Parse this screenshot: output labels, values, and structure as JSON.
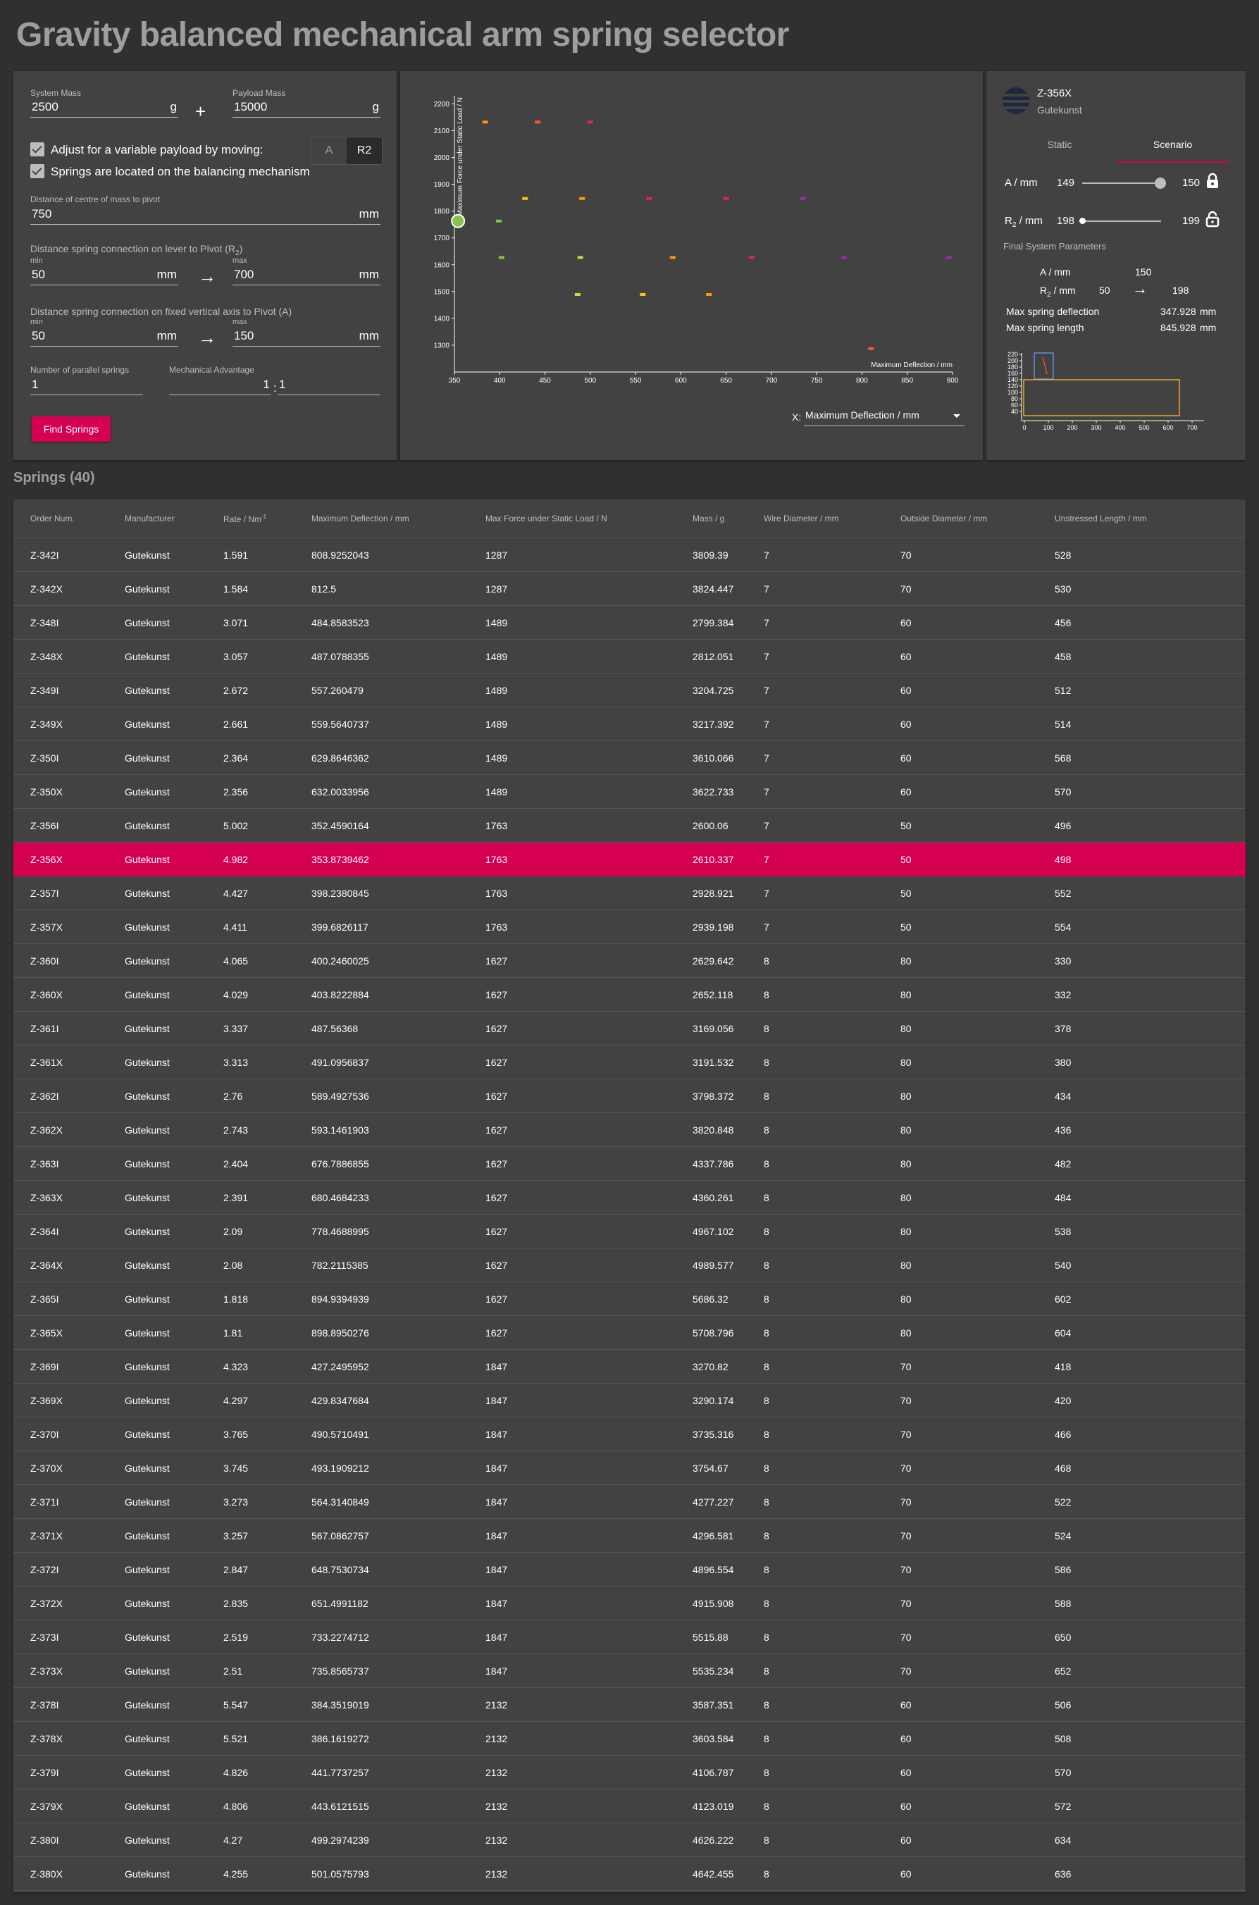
{
  "title": "Gravity balanced mechanical arm spring selector",
  "form": {
    "system_mass_label": "System Mass",
    "system_mass": "2500",
    "system_mass_unit": "g",
    "plus": "+",
    "payload_mass_label": "Payload Mass",
    "payload_mass": "15000",
    "payload_mass_unit": "g",
    "variable_payload_label": "Adjust for a variable payload by moving:",
    "toggle_a": "A",
    "toggle_r2": "R2",
    "springs_located_label": "Springs are located on the balancing mechanism",
    "com_label": "Distance of centre of mass to pivot",
    "com_value": "750",
    "com_unit": "mm",
    "lever_label": "Distance spring connection on lever to Pivot (R",
    "lever_label_sub": "2",
    "lever_label_end": ")",
    "lever_min_label": "min",
    "lever_min": "50",
    "lever_max_label": "max",
    "lever_max": "700",
    "unit_mm": "mm",
    "arrow": "→",
    "axis_label": "Distance spring connection on fixed vertical axis to Pivot (A)",
    "axis_min_label": "min",
    "axis_min": "50",
    "axis_max_label": "max",
    "axis_max": "150",
    "parallel_label": "Number of parallel springs",
    "parallel_value": "1",
    "mech_adv_label": "Mechanical Advantage",
    "mech_adv_left": "1",
    "mech_adv_sep": ":",
    "mech_adv_right": "1",
    "find_button": "Find Springs"
  },
  "chart_data": {
    "type": "scatter",
    "xlabel": "Maximum Deflection / mm",
    "ylabel": "Maximum Force under Static Load / N",
    "xlim": [
      350,
      900
    ],
    "ylim": [
      1200,
      2230
    ],
    "xticks": [
      350,
      400,
      450,
      500,
      550,
      600,
      650,
      700,
      750,
      800,
      850,
      900
    ],
    "yticks": [
      1300,
      1400,
      1500,
      1600,
      1700,
      1800,
      1900,
      2000,
      2100,
      2200
    ],
    "points": [
      {
        "x": 384,
        "y": 2132,
        "color": "#ff9800"
      },
      {
        "x": 442,
        "y": 2132,
        "color": "#ff5722"
      },
      {
        "x": 500,
        "y": 2132,
        "color": "#e91e63"
      },
      {
        "x": 428,
        "y": 1847,
        "color": "#ffc107"
      },
      {
        "x": 491,
        "y": 1847,
        "color": "#ff9800"
      },
      {
        "x": 565,
        "y": 1847,
        "color": "#e91e63"
      },
      {
        "x": 650,
        "y": 1847,
        "color": "#e91e63"
      },
      {
        "x": 735,
        "y": 1847,
        "color": "#9c27b0"
      },
      {
        "x": 352,
        "y": 1763,
        "color": "#ffffff"
      },
      {
        "x": 399,
        "y": 1763,
        "color": "#8bc34a"
      },
      {
        "x": 402,
        "y": 1627,
        "color": "#8bc34a"
      },
      {
        "x": 489,
        "y": 1627,
        "color": "#cddc39"
      },
      {
        "x": 591,
        "y": 1627,
        "color": "#ff9800"
      },
      {
        "x": 678,
        "y": 1627,
        "color": "#e91e63"
      },
      {
        "x": 780,
        "y": 1627,
        "color": "#9c27b0"
      },
      {
        "x": 896,
        "y": 1627,
        "color": "#9c27b0"
      },
      {
        "x": 486,
        "y": 1489,
        "color": "#cddc39"
      },
      {
        "x": 558,
        "y": 1489,
        "color": "#ffc107"
      },
      {
        "x": 631,
        "y": 1489,
        "color": "#ff9800"
      },
      {
        "x": 810,
        "y": 1287,
        "color": "#ff5722"
      }
    ],
    "selected": {
      "x": 354,
      "y": 1763
    }
  },
  "chart_ui": {
    "x_select_label": "X:",
    "x_select_value": "Maximum Deflection / mm"
  },
  "spring_card": {
    "name": "Z-356X",
    "manufacturer": "Gutekunst",
    "tab_static": "Static",
    "tab_scenario": "Scenario",
    "a_label": "A / mm",
    "a_current": "149",
    "a_max": "150",
    "a_fraction": 0.99,
    "r2_label": "R",
    "r2_sub": "2",
    "r2_label_end": " / mm",
    "r2_current": "198",
    "r2_max": "199",
    "r2_fraction": 0.0,
    "final_title": "Final System Parameters",
    "final_a_label": "A / mm",
    "final_a_value": "150",
    "final_r2_label": "R",
    "final_r2_sub": "2",
    "final_r2_label_end": " / mm",
    "final_r2_from": "50",
    "final_r2_arrow": "→",
    "final_r2_to": "198",
    "max_def_label": "Max spring deflection",
    "max_def_value": "347.928",
    "max_def_unit": "mm",
    "max_len_label": "Max spring length",
    "max_len_value": "845.928",
    "max_len_unit": "mm"
  },
  "mini_chart": {
    "yticks": [
      "220",
      "200",
      "180",
      "160",
      "140",
      "120",
      "100",
      "80",
      "60",
      "40"
    ],
    "xticks": [
      "0",
      "100",
      "200",
      "300",
      "400",
      "500",
      "600",
      "700"
    ],
    "outline_colors": {
      "blue": "#5b8fd6",
      "orange": "#f5a623"
    }
  },
  "springs": {
    "title": "Springs (40)",
    "columns": [
      "Order Num.",
      "Manufacturer",
      "Rate / Nm",
      "Maximum Deflection / mm",
      "Max Force under Static Load / N",
      "Mass / g",
      "Wire Diameter / mm",
      "Outside Diameter / mm",
      "Unstressed Length / mm"
    ],
    "rate_sup": "-1",
    "selected_index": 9,
    "rows": [
      [
        "Z-342I",
        "Gutekunst",
        "1.591",
        "808.9252043",
        "1287",
        "3809.39",
        "7",
        "70",
        "528"
      ],
      [
        "Z-342X",
        "Gutekunst",
        "1.584",
        "812.5",
        "1287",
        "3824.447",
        "7",
        "70",
        "530"
      ],
      [
        "Z-348I",
        "Gutekunst",
        "3.071",
        "484.8583523",
        "1489",
        "2799.384",
        "7",
        "60",
        "456"
      ],
      [
        "Z-348X",
        "Gutekunst",
        "3.057",
        "487.0788355",
        "1489",
        "2812.051",
        "7",
        "60",
        "458"
      ],
      [
        "Z-349I",
        "Gutekunst",
        "2.672",
        "557.260479",
        "1489",
        "3204.725",
        "7",
        "60",
        "512"
      ],
      [
        "Z-349X",
        "Gutekunst",
        "2.661",
        "559.5640737",
        "1489",
        "3217.392",
        "7",
        "60",
        "514"
      ],
      [
        "Z-350I",
        "Gutekunst",
        "2.364",
        "629.8646362",
        "1489",
        "3610.066",
        "7",
        "60",
        "568"
      ],
      [
        "Z-350X",
        "Gutekunst",
        "2.356",
        "632.0033956",
        "1489",
        "3622.733",
        "7",
        "60",
        "570"
      ],
      [
        "Z-356I",
        "Gutekunst",
        "5.002",
        "352.4590164",
        "1763",
        "2600.06",
        "7",
        "50",
        "496"
      ],
      [
        "Z-356X",
        "Gutekunst",
        "4.982",
        "353.8739462",
        "1763",
        "2610.337",
        "7",
        "50",
        "498"
      ],
      [
        "Z-357I",
        "Gutekunst",
        "4.427",
        "398.2380845",
        "1763",
        "2928.921",
        "7",
        "50",
        "552"
      ],
      [
        "Z-357X",
        "Gutekunst",
        "4.411",
        "399.6826117",
        "1763",
        "2939.198",
        "7",
        "50",
        "554"
      ],
      [
        "Z-360I",
        "Gutekunst",
        "4.065",
        "400.2460025",
        "1627",
        "2629.642",
        "8",
        "80",
        "330"
      ],
      [
        "Z-360X",
        "Gutekunst",
        "4.029",
        "403.8222884",
        "1627",
        "2652.118",
        "8",
        "80",
        "332"
      ],
      [
        "Z-361I",
        "Gutekunst",
        "3.337",
        "487.56368",
        "1627",
        "3169.056",
        "8",
        "80",
        "378"
      ],
      [
        "Z-361X",
        "Gutekunst",
        "3.313",
        "491.0956837",
        "1627",
        "3191.532",
        "8",
        "80",
        "380"
      ],
      [
        "Z-362I",
        "Gutekunst",
        "2.76",
        "589.4927536",
        "1627",
        "3798.372",
        "8",
        "80",
        "434"
      ],
      [
        "Z-362X",
        "Gutekunst",
        "2.743",
        "593.1461903",
        "1627",
        "3820.848",
        "8",
        "80",
        "436"
      ],
      [
        "Z-363I",
        "Gutekunst",
        "2.404",
        "676.7886855",
        "1627",
        "4337.786",
        "8",
        "80",
        "482"
      ],
      [
        "Z-363X",
        "Gutekunst",
        "2.391",
        "680.4684233",
        "1627",
        "4360.261",
        "8",
        "80",
        "484"
      ],
      [
        "Z-364I",
        "Gutekunst",
        "2.09",
        "778.4688995",
        "1627",
        "4967.102",
        "8",
        "80",
        "538"
      ],
      [
        "Z-364X",
        "Gutekunst",
        "2.08",
        "782.2115385",
        "1627",
        "4989.577",
        "8",
        "80",
        "540"
      ],
      [
        "Z-365I",
        "Gutekunst",
        "1.818",
        "894.9394939",
        "1627",
        "5686.32",
        "8",
        "80",
        "602"
      ],
      [
        "Z-365X",
        "Gutekunst",
        "1.81",
        "898.8950276",
        "1627",
        "5708.796",
        "8",
        "80",
        "604"
      ],
      [
        "Z-369I",
        "Gutekunst",
        "4.323",
        "427.2495952",
        "1847",
        "3270.82",
        "8",
        "70",
        "418"
      ],
      [
        "Z-369X",
        "Gutekunst",
        "4.297",
        "429.8347684",
        "1847",
        "3290.174",
        "8",
        "70",
        "420"
      ],
      [
        "Z-370I",
        "Gutekunst",
        "3.765",
        "490.5710491",
        "1847",
        "3735.316",
        "8",
        "70",
        "466"
      ],
      [
        "Z-370X",
        "Gutekunst",
        "3.745",
        "493.1909212",
        "1847",
        "3754.67",
        "8",
        "70",
        "468"
      ],
      [
        "Z-371I",
        "Gutekunst",
        "3.273",
        "564.3140849",
        "1847",
        "4277.227",
        "8",
        "70",
        "522"
      ],
      [
        "Z-371X",
        "Gutekunst",
        "3.257",
        "567.0862757",
        "1847",
        "4296.581",
        "8",
        "70",
        "524"
      ],
      [
        "Z-372I",
        "Gutekunst",
        "2.847",
        "648.7530734",
        "1847",
        "4896.554",
        "8",
        "70",
        "586"
      ],
      [
        "Z-372X",
        "Gutekunst",
        "2.835",
        "651.4991182",
        "1847",
        "4915.908",
        "8",
        "70",
        "588"
      ],
      [
        "Z-373I",
        "Gutekunst",
        "2.519",
        "733.2274712",
        "1847",
        "5515.88",
        "8",
        "70",
        "650"
      ],
      [
        "Z-373X",
        "Gutekunst",
        "2.51",
        "735.8565737",
        "1847",
        "5535.234",
        "8",
        "70",
        "652"
      ],
      [
        "Z-378I",
        "Gutekunst",
        "5.547",
        "384.3519019",
        "2132",
        "3587.351",
        "8",
        "60",
        "506"
      ],
      [
        "Z-378X",
        "Gutekunst",
        "5.521",
        "386.1619272",
        "2132",
        "3603.584",
        "8",
        "60",
        "508"
      ],
      [
        "Z-379I",
        "Gutekunst",
        "4.826",
        "441.7737257",
        "2132",
        "4106.787",
        "8",
        "60",
        "570"
      ],
      [
        "Z-379X",
        "Gutekunst",
        "4.806",
        "443.6121515",
        "2132",
        "4123.019",
        "8",
        "60",
        "572"
      ],
      [
        "Z-380I",
        "Gutekunst",
        "4.27",
        "499.2974239",
        "2132",
        "4626.222",
        "8",
        "60",
        "634"
      ],
      [
        "Z-380X",
        "Gutekunst",
        "4.255",
        "501.0575793",
        "2132",
        "4642.455",
        "8",
        "60",
        "636"
      ]
    ]
  }
}
